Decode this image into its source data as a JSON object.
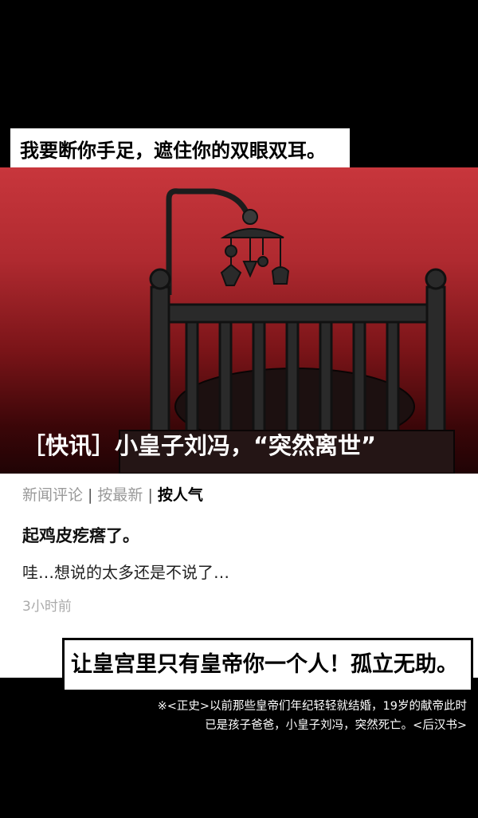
{
  "captions": {
    "top": "我要断你手足，遮住你的双眼双耳。",
    "bottom": "让皇宫里只有皇帝你一个人！孤立无助。"
  },
  "scene": {
    "headline": "［快讯］小皇子刘冯，“突然离世”",
    "illustration": "crib-with-mobile",
    "background_color": "#c8363c"
  },
  "comments": {
    "tabs": [
      "新闻评论",
      "按最新",
      "按人气"
    ],
    "active_tab": "按人气",
    "items": [
      {
        "title": "起鸡皮疙瘩了。",
        "body": "哇…想说的太多还是不说了…",
        "time": "3小时前"
      }
    ]
  },
  "footnote": {
    "line1": "※<正史>以前那些皇帝们年纪轻轻就结婚，19岁的献帝此时",
    "line2": "已是孩子爸爸，小皇子刘冯，突然死亡。<后汉书>"
  }
}
